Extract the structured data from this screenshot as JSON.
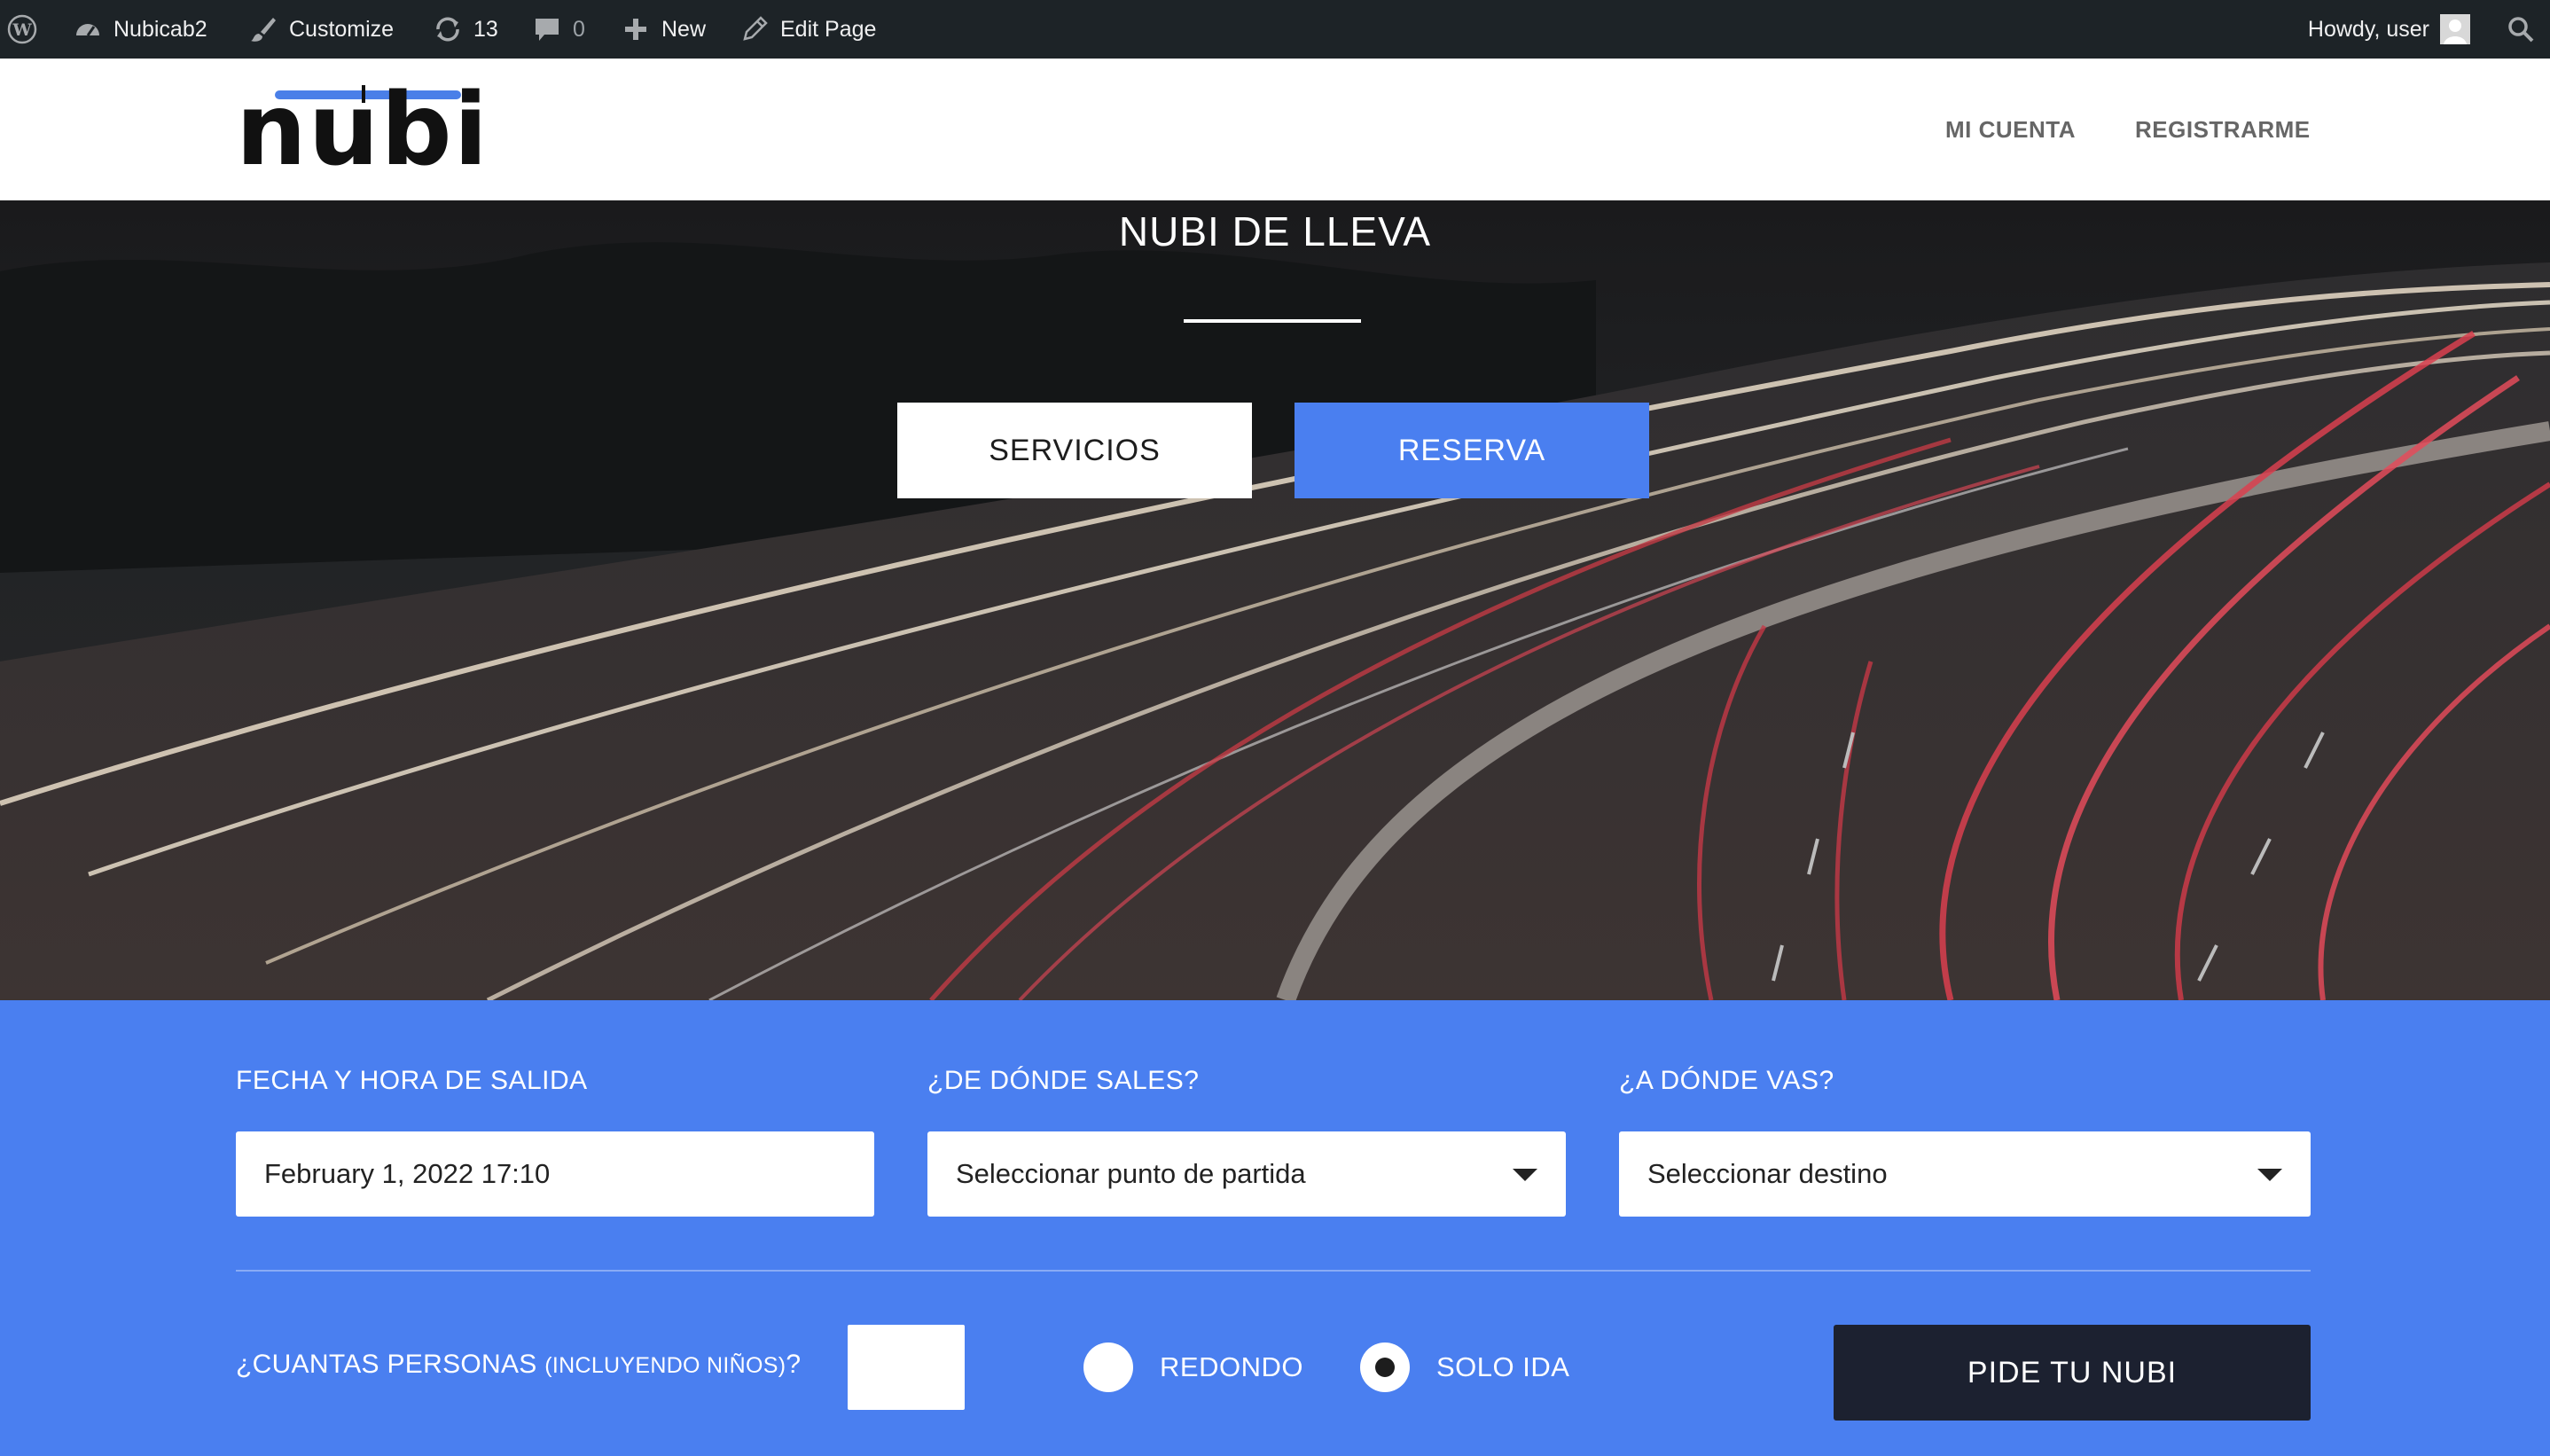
{
  "admin_bar": {
    "site_name": "Nubicab2",
    "customize": "Customize",
    "updates_count": "13",
    "comments_count": "0",
    "new": "New",
    "edit_page": "Edit Page",
    "greeting": "Howdy, user"
  },
  "header": {
    "logo_text": "nubi",
    "nav": [
      "MI CUENTA",
      "REGISTRARME"
    ]
  },
  "hero": {
    "title": "NUBI DE LLEVA",
    "buttons": {
      "servicios": "SERVICIOS",
      "reserva": "RESERVA"
    }
  },
  "booking": {
    "departure": {
      "label": "FECHA Y HORA DE SALIDA",
      "value": "February 1, 2022 17:10"
    },
    "origin": {
      "label": "¿DE DÓNDE SALES?",
      "value": "Seleccionar punto de partida"
    },
    "destination": {
      "label": "¿A DÓNDE VAS?",
      "value": "Seleccionar destino"
    },
    "persons": {
      "label": "¿CUANTAS PERSONAS",
      "label_small": "(INCLUYENDO NIÑOS)",
      "label_end": "?",
      "value": ""
    },
    "trip_type": {
      "options": [
        {
          "label": "REDONDO",
          "selected": false
        },
        {
          "label": "SOLO IDA",
          "selected": true
        }
      ]
    },
    "submit": "PIDE TU NUBI"
  },
  "colors": {
    "admin_bar": "#1d2327",
    "brand_blue": "#4a7ff0",
    "submit_dark": "#1c2130"
  },
  "icons": [
    "wordpress-icon",
    "dashboard-icon",
    "brush-icon",
    "updates-icon",
    "comment-icon",
    "plus-icon",
    "pencil-icon",
    "avatar",
    "search-icon",
    "chevron-down-icon"
  ]
}
